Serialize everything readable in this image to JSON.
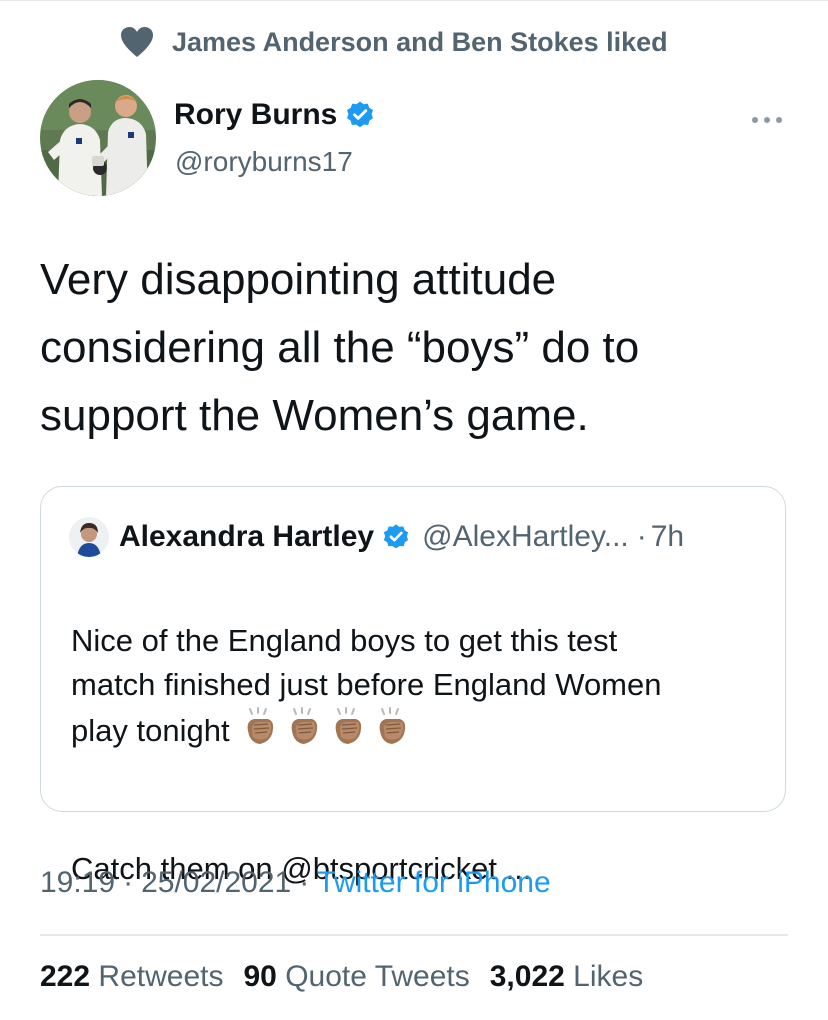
{
  "social_context": {
    "text": "James Anderson and Ben Stokes liked",
    "icon": "heart-icon"
  },
  "author": {
    "name": "Rory Burns",
    "handle": "@roryburns17",
    "verified": true
  },
  "tweet": {
    "text": "Very disappointing attitude\nconsidering all the “boys” do to\nsupport the Women’s game."
  },
  "quoted_tweet": {
    "name": "Alexandra Hartley",
    "handle": "@AlexHartley...",
    "separator": "·",
    "time": "7h",
    "text_main": "Nice of the England boys to get this test\nmatch finished just before England Women\nplay tonight",
    "text_more": "Catch them on @btsportcricket ...",
    "emoji": "clapping-hands-x4"
  },
  "meta": {
    "time": "19:19",
    "sep1": "·",
    "date": "25/02/2021",
    "sep2": "·",
    "source": "Twitter for iPhone"
  },
  "stats": {
    "retweets_count": "222",
    "retweets_label": "Retweets",
    "quotes_count": "90",
    "quotes_label": "Quote Tweets",
    "likes_count": "3,022",
    "likes_label": "Likes"
  },
  "colors": {
    "accent": "#1d9bf0",
    "secondary_text": "#536471",
    "primary_text": "#0f1419",
    "border": "#cfd9de"
  }
}
